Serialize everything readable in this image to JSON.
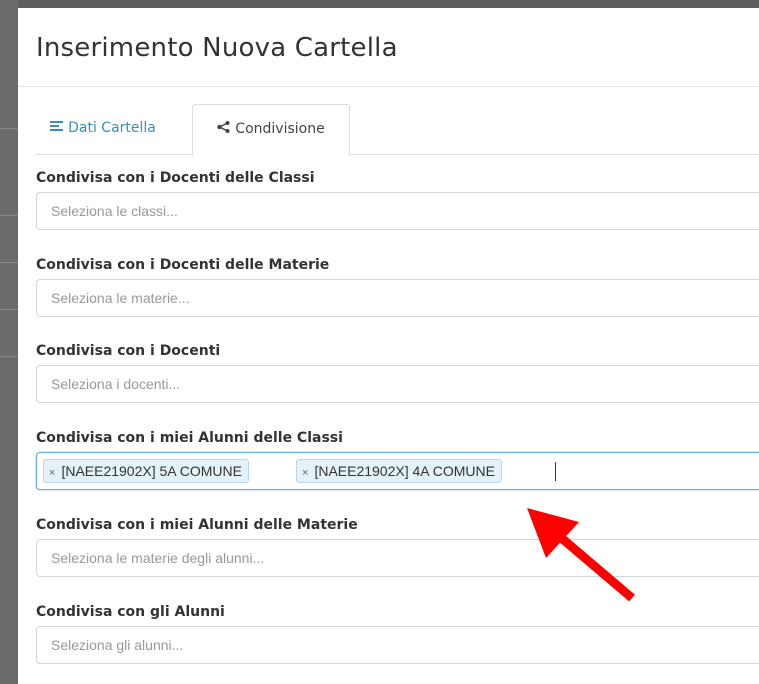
{
  "modal": {
    "title": "Inserimento Nuova Cartella",
    "tabs": [
      {
        "label": "Dati Cartella",
        "icon": "list-icon",
        "active": false
      },
      {
        "label": "Condivisione",
        "icon": "share-icon",
        "active": true
      }
    ]
  },
  "fields": {
    "classi": {
      "label": "Condivisa con i Docenti delle Classi",
      "placeholder": "Seleziona le classi..."
    },
    "materie": {
      "label": "Condivisa con i Docenti delle Materie",
      "placeholder": "Seleziona le materie..."
    },
    "docenti": {
      "label": "Condivisa con i Docenti",
      "placeholder": "Seleziona i docenti..."
    },
    "alunni_classi": {
      "label": "Condivisa con i miei Alunni delle Classi",
      "tags": [
        "[NAEE21902X] 5A COMUNE",
        "[NAEE21902X] 4A COMUNE"
      ],
      "tag_remove_symbol": "×"
    },
    "alunni_materie": {
      "label": "Condivisa con i miei Alunni delle Materie",
      "placeholder": "Seleziona le materie degli alunni..."
    },
    "alunni": {
      "label": "Condivisa con gli Alunni",
      "placeholder": "Seleziona gli alunni..."
    }
  },
  "annotation": {
    "arrow_color": "#ff0000"
  },
  "colors": {
    "link_blue": "#3c8dbc",
    "focus_border": "#66afe9",
    "tag_bg": "#e4f1f8"
  }
}
